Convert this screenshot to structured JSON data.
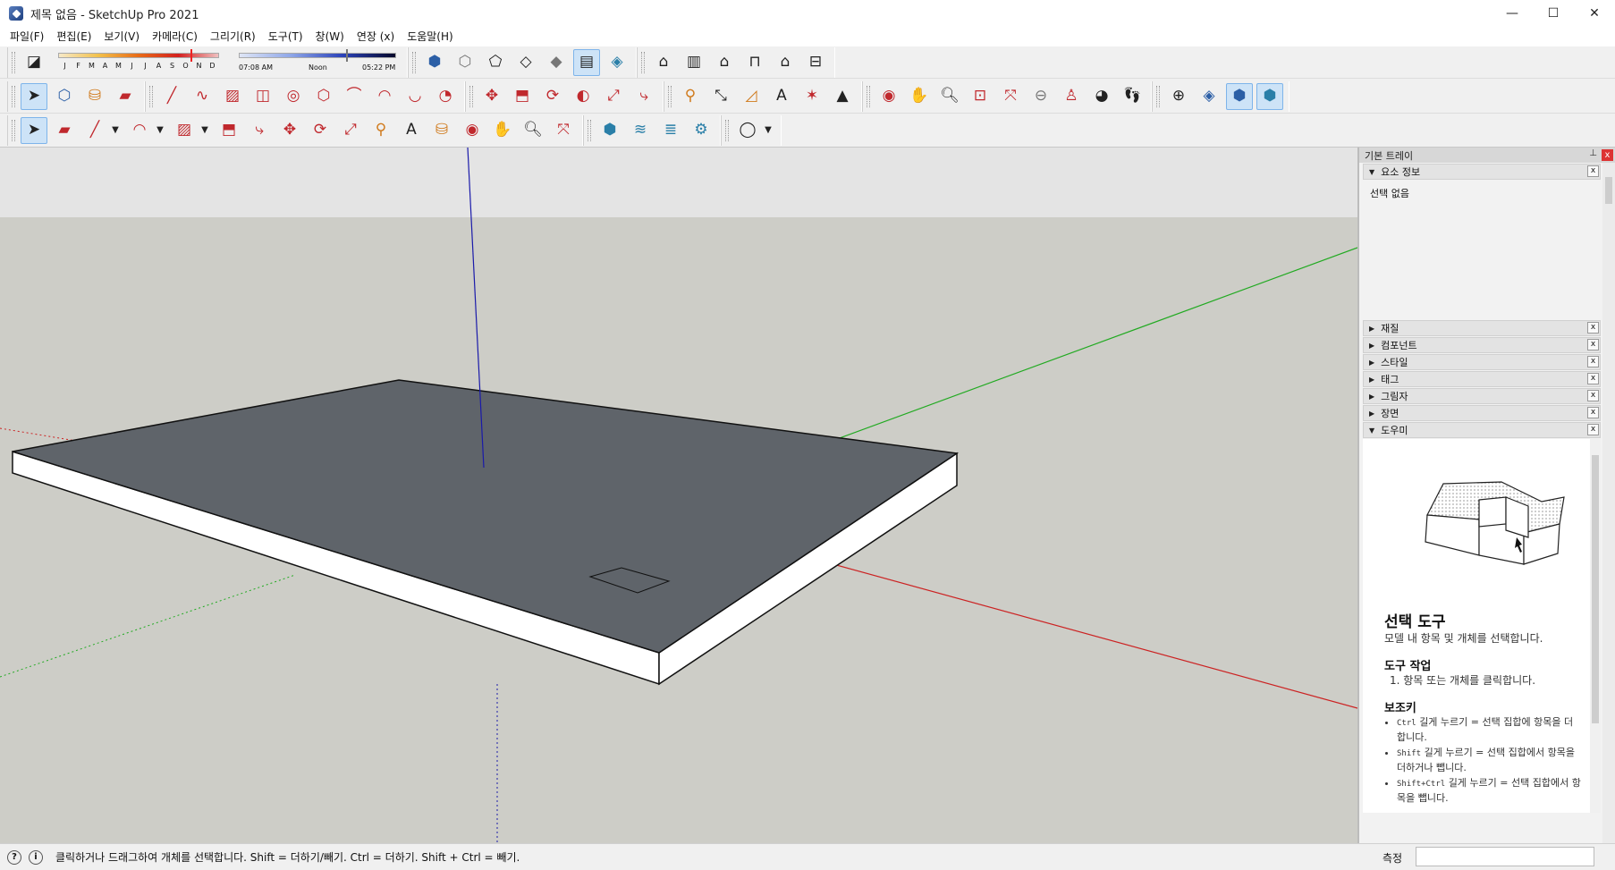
{
  "window": {
    "title": "제목 없음 - SketchUp Pro 2021",
    "controls": {
      "minimize": "—",
      "maximize": "☐",
      "close": "✕"
    }
  },
  "menu": [
    "파일(F)",
    "편집(E)",
    "보기(V)",
    "카메라(C)",
    "그리기(R)",
    "도구(T)",
    "창(W)",
    "연장 (x)",
    "도움말(H)"
  ],
  "shadow": {
    "months": [
      "J",
      "F",
      "M",
      "A",
      "M",
      "J",
      "J",
      "A",
      "S",
      "O",
      "N",
      "D"
    ],
    "time_start": "07:08 AM",
    "time_mid": "Noon",
    "time_end": "05:22 PM"
  },
  "tray": {
    "title": "기본 트레이",
    "pin": "⊥",
    "close": "x",
    "entity_info": {
      "label": "요소 정보",
      "content": "선택 없음"
    },
    "panels": [
      "재질",
      "컴포넌트",
      "스타일",
      "태그",
      "그림자",
      "장면",
      "도우미"
    ]
  },
  "instructor": {
    "title": "선택 도구",
    "description": "모델 내 항목 및 개체를 선택합니다.",
    "ops_heading": "도구 작업",
    "ops_text": "1. 항목 또는 개체를 클릭합니다.",
    "keys_heading": "보조키",
    "keys": [
      {
        "key": "Ctrl",
        "text": "길게 누르기 = 선택 집합에 항목을 더합니다."
      },
      {
        "key": "Shift",
        "text": "길게 누르기 = 선택 집합에서 항목을 더하거나 뺍니다."
      },
      {
        "key": "Shift+Ctrl",
        "text": "길게 누르기 = 선택 집합에서 항목을 뺍니다."
      }
    ]
  },
  "status": {
    "message": "클릭하거나 드래그하여 개체를 선택합니다. Shift = 더하기/빼기. Ctrl = 더하기. Shift + Ctrl = 빼기.",
    "measure_label": "측정",
    "measure_value": ""
  },
  "colors": {
    "sky": "#e4e4e4",
    "ground": "#cdcdc7",
    "face_top": "#5f646a",
    "face_side": "#ffffff",
    "axis_red": "#cc2222",
    "axis_green": "#22aa22",
    "axis_blue": "#1a1aaa",
    "active_tool": "#cde3f7"
  }
}
